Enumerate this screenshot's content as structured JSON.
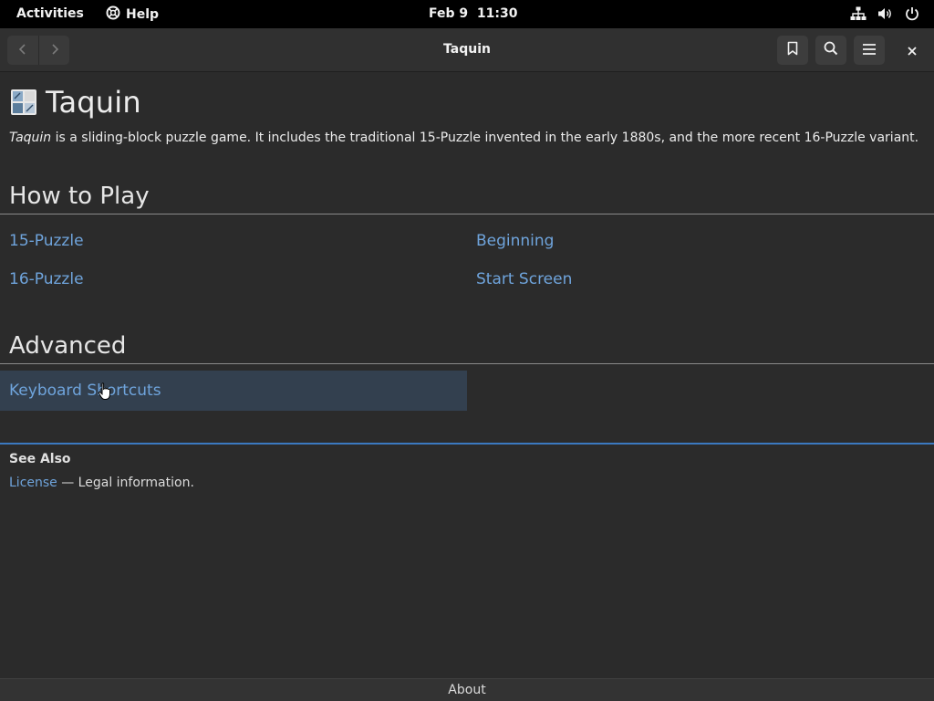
{
  "topbar": {
    "activities": "Activities",
    "app_name": "Help",
    "clock": "Feb 9  11:30",
    "icons": [
      "help-lifebuoy-icon",
      "network-icon",
      "volume-icon",
      "power-icon"
    ]
  },
  "headerbar": {
    "title": "Taquin",
    "icons": [
      "back-arrow-icon",
      "forward-arrow-icon",
      "bookmark-icon",
      "search-icon",
      "hamburger-menu-icon",
      "close-icon"
    ]
  },
  "page": {
    "title": "Taquin",
    "intro_emphasis": "Taquin",
    "intro_rest": " is a sliding-block puzzle game. It includes the traditional 15-Puzzle invented in the early 1880s, and the more recent 16-Puzzle variant."
  },
  "sections": {
    "how_to_play": {
      "title": "How to Play",
      "links": [
        "15-Puzzle",
        "16-Puzzle",
        "Beginning",
        "Start Screen"
      ]
    },
    "advanced": {
      "title": "Advanced",
      "links": [
        "Keyboard Shortcuts"
      ]
    }
  },
  "see_also": {
    "title": "See Also",
    "link": "License",
    "description": " — Legal information."
  },
  "footer": {
    "about": "About"
  },
  "colors": {
    "link": "#6fa4dc",
    "accent_rule": "#3b79c0",
    "hover_row": "#33404f",
    "background": "#2b2b2b"
  }
}
